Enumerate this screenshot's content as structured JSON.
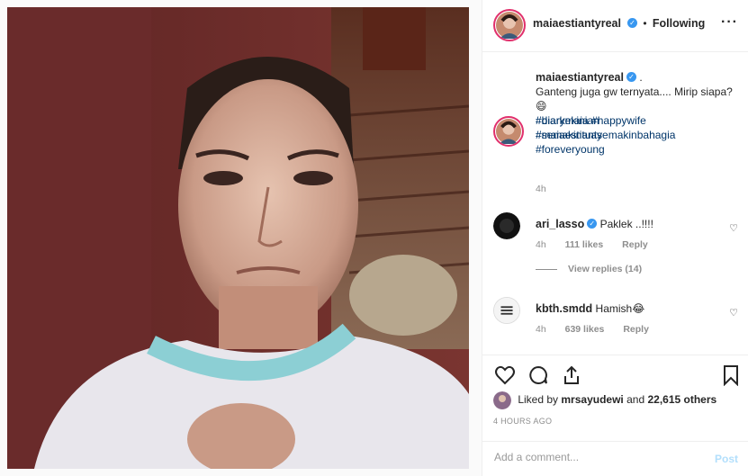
{
  "post": {
    "author": "maiaestiantyreal",
    "follow_separator": "•",
    "follow_status": "Following",
    "more_label": "···"
  },
  "caption": {
    "author": "maiaestiantyreal",
    "suffix": ".",
    "text": "Ganteng juga gw ternyata.... Mirip siapa?",
    "emoji": "😄",
    "hashtags": [
      "#biarkekinian",
      "#maiaestianty",
      "#diarymaia",
      "#happywife",
      "#semakintuasemakinbahagia",
      "#foreveryoung"
    ],
    "time": "4h"
  },
  "comments": [
    {
      "user": "ari_lasso",
      "verified": true,
      "text": "Paklek ..!!!!",
      "time": "4h",
      "likes": "111 likes",
      "reply": "Reply"
    },
    {
      "user": "kbth.smdd",
      "verified": false,
      "text": "Hamish😂",
      "time": "4h",
      "likes": "639 likes",
      "reply": "Reply"
    }
  ],
  "view_replies": "View replies (14)",
  "likes": {
    "prefix": "Liked by",
    "user": "mrsayudewi",
    "middle": "and",
    "others": "22,615 others"
  },
  "timestamp": "4 HOURS AGO",
  "add_comment": {
    "placeholder": "Add a comment...",
    "post": "Post"
  },
  "icons": [
    "heart-icon",
    "comment-icon",
    "share-icon",
    "bookmark-icon",
    "verified-icon",
    "more-icon"
  ],
  "colors": {
    "accent": "#3897f0",
    "hashtag": "#003569",
    "muted": "#8e8e8e",
    "post_disabled": "#b2dffc"
  }
}
